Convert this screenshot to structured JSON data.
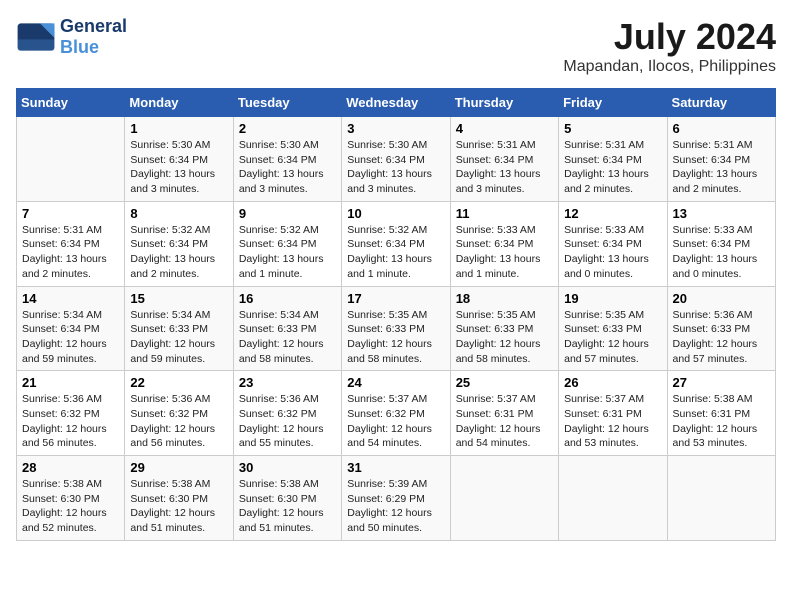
{
  "header": {
    "logo_line1": "General",
    "logo_line2": "Blue",
    "month_year": "July 2024",
    "location": "Mapandan, Ilocos, Philippines"
  },
  "weekdays": [
    "Sunday",
    "Monday",
    "Tuesday",
    "Wednesday",
    "Thursday",
    "Friday",
    "Saturday"
  ],
  "weeks": [
    [
      {
        "day": "",
        "sunrise": "",
        "sunset": "",
        "daylight": ""
      },
      {
        "day": "1",
        "sunrise": "Sunrise: 5:30 AM",
        "sunset": "Sunset: 6:34 PM",
        "daylight": "Daylight: 13 hours and 3 minutes."
      },
      {
        "day": "2",
        "sunrise": "Sunrise: 5:30 AM",
        "sunset": "Sunset: 6:34 PM",
        "daylight": "Daylight: 13 hours and 3 minutes."
      },
      {
        "day": "3",
        "sunrise": "Sunrise: 5:30 AM",
        "sunset": "Sunset: 6:34 PM",
        "daylight": "Daylight: 13 hours and 3 minutes."
      },
      {
        "day": "4",
        "sunrise": "Sunrise: 5:31 AM",
        "sunset": "Sunset: 6:34 PM",
        "daylight": "Daylight: 13 hours and 3 minutes."
      },
      {
        "day": "5",
        "sunrise": "Sunrise: 5:31 AM",
        "sunset": "Sunset: 6:34 PM",
        "daylight": "Daylight: 13 hours and 2 minutes."
      },
      {
        "day": "6",
        "sunrise": "Sunrise: 5:31 AM",
        "sunset": "Sunset: 6:34 PM",
        "daylight": "Daylight: 13 hours and 2 minutes."
      }
    ],
    [
      {
        "day": "7",
        "sunrise": "Sunrise: 5:31 AM",
        "sunset": "Sunset: 6:34 PM",
        "daylight": "Daylight: 13 hours and 2 minutes."
      },
      {
        "day": "8",
        "sunrise": "Sunrise: 5:32 AM",
        "sunset": "Sunset: 6:34 PM",
        "daylight": "Daylight: 13 hours and 2 minutes."
      },
      {
        "day": "9",
        "sunrise": "Sunrise: 5:32 AM",
        "sunset": "Sunset: 6:34 PM",
        "daylight": "Daylight: 13 hours and 1 minute."
      },
      {
        "day": "10",
        "sunrise": "Sunrise: 5:32 AM",
        "sunset": "Sunset: 6:34 PM",
        "daylight": "Daylight: 13 hours and 1 minute."
      },
      {
        "day": "11",
        "sunrise": "Sunrise: 5:33 AM",
        "sunset": "Sunset: 6:34 PM",
        "daylight": "Daylight: 13 hours and 1 minute."
      },
      {
        "day": "12",
        "sunrise": "Sunrise: 5:33 AM",
        "sunset": "Sunset: 6:34 PM",
        "daylight": "Daylight: 13 hours and 0 minutes."
      },
      {
        "day": "13",
        "sunrise": "Sunrise: 5:33 AM",
        "sunset": "Sunset: 6:34 PM",
        "daylight": "Daylight: 13 hours and 0 minutes."
      }
    ],
    [
      {
        "day": "14",
        "sunrise": "Sunrise: 5:34 AM",
        "sunset": "Sunset: 6:34 PM",
        "daylight": "Daylight: 12 hours and 59 minutes."
      },
      {
        "day": "15",
        "sunrise": "Sunrise: 5:34 AM",
        "sunset": "Sunset: 6:33 PM",
        "daylight": "Daylight: 12 hours and 59 minutes."
      },
      {
        "day": "16",
        "sunrise": "Sunrise: 5:34 AM",
        "sunset": "Sunset: 6:33 PM",
        "daylight": "Daylight: 12 hours and 58 minutes."
      },
      {
        "day": "17",
        "sunrise": "Sunrise: 5:35 AM",
        "sunset": "Sunset: 6:33 PM",
        "daylight": "Daylight: 12 hours and 58 minutes."
      },
      {
        "day": "18",
        "sunrise": "Sunrise: 5:35 AM",
        "sunset": "Sunset: 6:33 PM",
        "daylight": "Daylight: 12 hours and 58 minutes."
      },
      {
        "day": "19",
        "sunrise": "Sunrise: 5:35 AM",
        "sunset": "Sunset: 6:33 PM",
        "daylight": "Daylight: 12 hours and 57 minutes."
      },
      {
        "day": "20",
        "sunrise": "Sunrise: 5:36 AM",
        "sunset": "Sunset: 6:33 PM",
        "daylight": "Daylight: 12 hours and 57 minutes."
      }
    ],
    [
      {
        "day": "21",
        "sunrise": "Sunrise: 5:36 AM",
        "sunset": "Sunset: 6:32 PM",
        "daylight": "Daylight: 12 hours and 56 minutes."
      },
      {
        "day": "22",
        "sunrise": "Sunrise: 5:36 AM",
        "sunset": "Sunset: 6:32 PM",
        "daylight": "Daylight: 12 hours and 56 minutes."
      },
      {
        "day": "23",
        "sunrise": "Sunrise: 5:36 AM",
        "sunset": "Sunset: 6:32 PM",
        "daylight": "Daylight: 12 hours and 55 minutes."
      },
      {
        "day": "24",
        "sunrise": "Sunrise: 5:37 AM",
        "sunset": "Sunset: 6:32 PM",
        "daylight": "Daylight: 12 hours and 54 minutes."
      },
      {
        "day": "25",
        "sunrise": "Sunrise: 5:37 AM",
        "sunset": "Sunset: 6:31 PM",
        "daylight": "Daylight: 12 hours and 54 minutes."
      },
      {
        "day": "26",
        "sunrise": "Sunrise: 5:37 AM",
        "sunset": "Sunset: 6:31 PM",
        "daylight": "Daylight: 12 hours and 53 minutes."
      },
      {
        "day": "27",
        "sunrise": "Sunrise: 5:38 AM",
        "sunset": "Sunset: 6:31 PM",
        "daylight": "Daylight: 12 hours and 53 minutes."
      }
    ],
    [
      {
        "day": "28",
        "sunrise": "Sunrise: 5:38 AM",
        "sunset": "Sunset: 6:30 PM",
        "daylight": "Daylight: 12 hours and 52 minutes."
      },
      {
        "day": "29",
        "sunrise": "Sunrise: 5:38 AM",
        "sunset": "Sunset: 6:30 PM",
        "daylight": "Daylight: 12 hours and 51 minutes."
      },
      {
        "day": "30",
        "sunrise": "Sunrise: 5:38 AM",
        "sunset": "Sunset: 6:30 PM",
        "daylight": "Daylight: 12 hours and 51 minutes."
      },
      {
        "day": "31",
        "sunrise": "Sunrise: 5:39 AM",
        "sunset": "Sunset: 6:29 PM",
        "daylight": "Daylight: 12 hours and 50 minutes."
      },
      {
        "day": "",
        "sunrise": "",
        "sunset": "",
        "daylight": ""
      },
      {
        "day": "",
        "sunrise": "",
        "sunset": "",
        "daylight": ""
      },
      {
        "day": "",
        "sunrise": "",
        "sunset": "",
        "daylight": ""
      }
    ]
  ]
}
